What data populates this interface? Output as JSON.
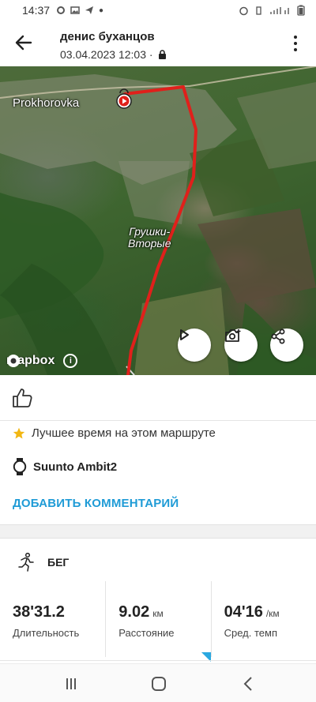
{
  "status_bar": {
    "time": "14:37"
  },
  "header": {
    "user_name": "денис буханцов",
    "date_time": "03.04.2023 12:03 ·"
  },
  "map": {
    "city_label": "Prokhorovka",
    "village_label_line1": "Грушки-",
    "village_label_line2": "Вторые",
    "attribution": "mapbox",
    "route_color": "#e0201b"
  },
  "achievement": {
    "text": "Лучшее время на этом маршруте",
    "star_color": "#f2b713"
  },
  "device": {
    "name": "Suunto Ambit2"
  },
  "actions": {
    "add_comment": "ДОБАВИТЬ КОММЕНТАРИЙ"
  },
  "activity": {
    "sport": "БЕГ"
  },
  "stats": [
    {
      "value": "38'31.2",
      "unit": "",
      "label": "Длительность"
    },
    {
      "value": "9.02",
      "unit": "км",
      "label": "Расстояние"
    },
    {
      "value": "04'16",
      "unit": "/км",
      "label": "Сред. темп"
    }
  ],
  "colors": {
    "accent": "#1f9bd6"
  }
}
